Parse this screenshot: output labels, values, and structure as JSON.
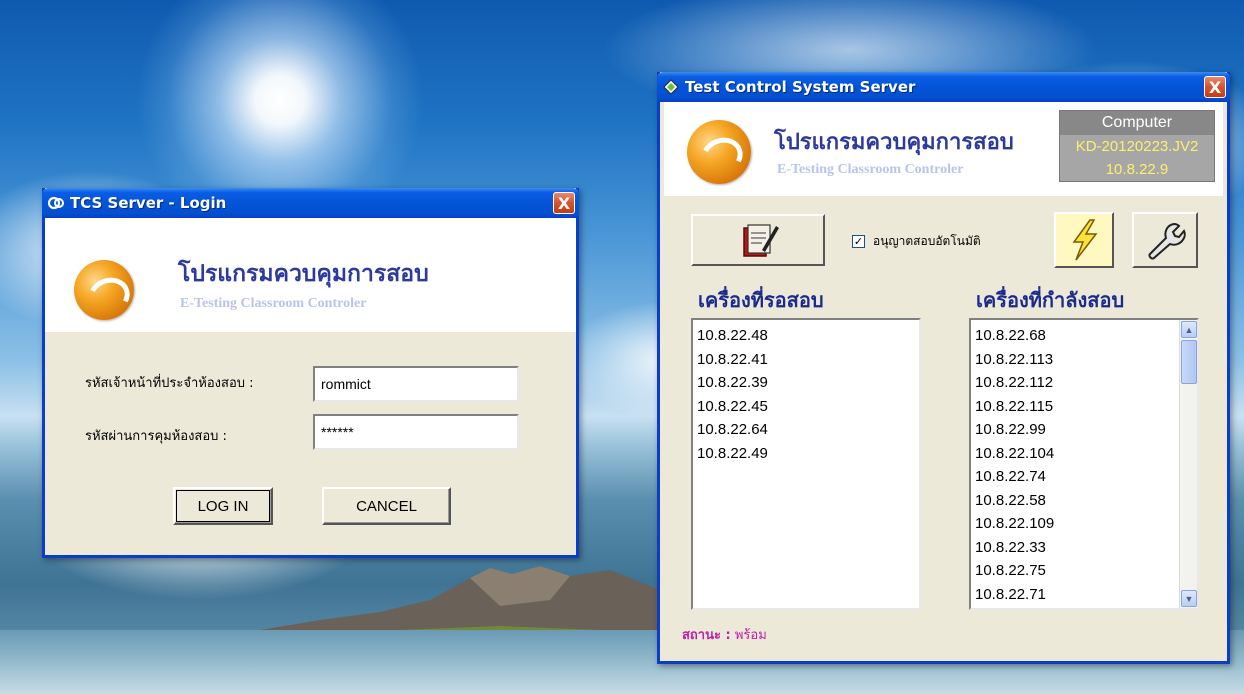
{
  "login_window": {
    "title": "TCS Server - Login",
    "close_label": "X",
    "logo": {
      "thai_title": "โปรแกรมควบคุมการสอบ",
      "english_title": "E-Testing Classroom Controler"
    },
    "fields": {
      "officer_label": "รหัสเจ้าหน้าที่ประจำห้องสอบ :",
      "officer_value": "rommict",
      "password_label": "รหัสผ่านการคุมห้องสอบ :",
      "password_value": "******"
    },
    "buttons": {
      "login": "LOG IN",
      "cancel": "CANCEL"
    }
  },
  "server_window": {
    "title": "Test Control System Server",
    "close_label": "X",
    "logo": {
      "thai_title": "โปรแกรมควบคุมการสอบ",
      "english_title": "E-Testing Classroom Controler"
    },
    "computer": {
      "header": "Computer",
      "name": "KD-20120223.JV2",
      "ip": "10.8.22.9"
    },
    "auto_allow": {
      "label": "อนุญาตสอบอัตโนมัติ",
      "checked": true,
      "check_glyph": "✓"
    },
    "waiting_list": {
      "heading": "เครื่องที่รอสอบ",
      "items": [
        "10.8.22.48",
        "10.8.22.41",
        "10.8.22.39",
        "10.8.22.45",
        "10.8.22.64",
        "10.8.22.49"
      ]
    },
    "testing_list": {
      "heading": "เครื่องที่กำลังสอบ",
      "items": [
        "10.8.22.68",
        "10.8.22.113",
        "10.8.22.112",
        "10.8.22.115",
        "10.8.22.99",
        "10.8.22.104",
        "10.8.22.74",
        "10.8.22.58",
        "10.8.22.109",
        "10.8.22.33",
        "10.8.22.75",
        "10.8.22.71"
      ]
    },
    "status": {
      "label": "สถานะ :",
      "value": "พร้อม"
    }
  },
  "icons": {
    "login_title_icon": "tcs-icon",
    "server_title_icon": "tcs-diamond-icon",
    "toolbar": [
      "exam-form-icon",
      "lightning-icon",
      "wrench-icon"
    ]
  },
  "colors": {
    "titlebar": "#0453d8",
    "thai_title": "#2b3a9c",
    "list_heading": "#1b2a8c",
    "status_text": "#c01ea8",
    "computer_value": "#ffef6c"
  }
}
